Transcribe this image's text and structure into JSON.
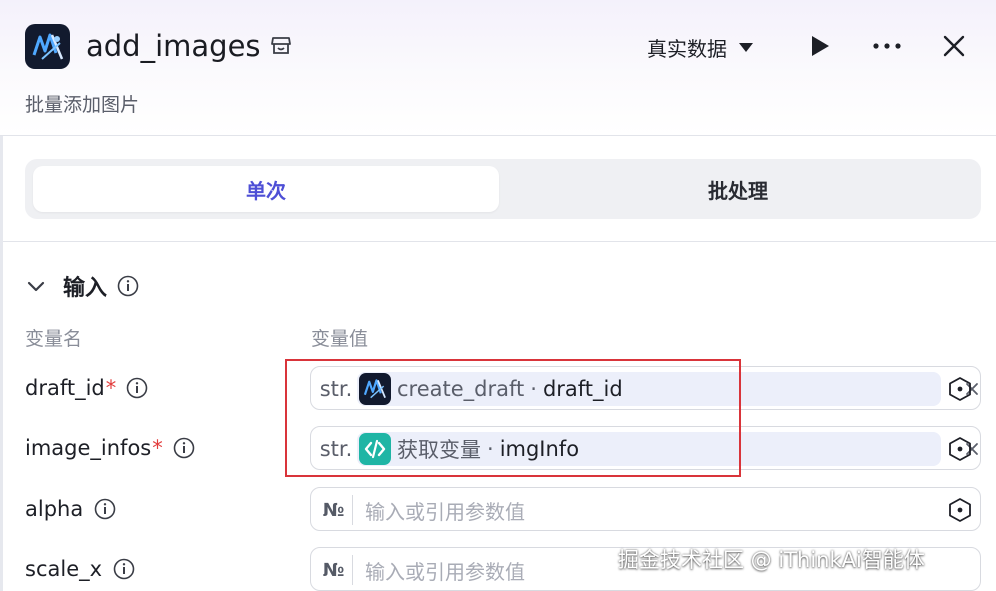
{
  "header": {
    "title": "add_images",
    "subtitle": "批量添加图片",
    "mode_select": "真实数据"
  },
  "tabs": [
    {
      "label": "单次",
      "active": true
    },
    {
      "label": "批处理",
      "active": false
    }
  ],
  "input_section": {
    "title": "输入",
    "col_name_header": "变量名",
    "col_value_header": "变量值",
    "rows": [
      {
        "name": "draft_id",
        "required": "*",
        "type": "str.",
        "ref_node": "create_draft",
        "ref_sep": "·",
        "ref_var": "draft_id",
        "ref_icon": "app-logo-icon"
      },
      {
        "name": "image_infos",
        "required": "*",
        "type": "str.",
        "ref_node": "获取变量",
        "ref_sep": "·",
        "ref_var": "imgInfo",
        "ref_icon": "code-icon"
      },
      {
        "name": "alpha",
        "required": "",
        "type": "№",
        "placeholder": "输入或引用参数值"
      },
      {
        "name": "scale_x",
        "required": "",
        "type": "№",
        "placeholder": "输入或引用参数值"
      }
    ]
  },
  "watermark": "掘金技术社区 @ iThinkAi智能体",
  "colors": {
    "accent": "#4e4fd6",
    "required": "#e23d3d",
    "highlight": "#d9343a",
    "chip_bg": "#eceffa",
    "code_icon_bg": "#1fb5a5"
  }
}
